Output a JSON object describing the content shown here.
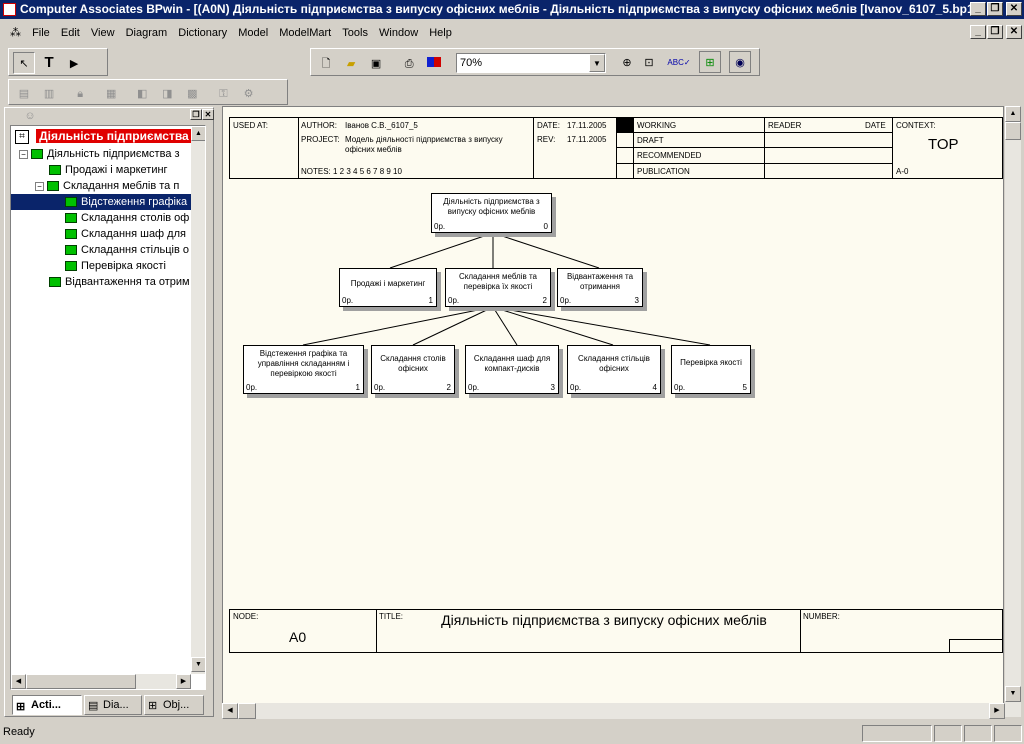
{
  "window": {
    "title": "Computer Associates BPwin - [(A0N) Діяльність підприємства  з випуску офісних меблів - Діяльність підприємства  з випуску офісних меблів  [Ivanov_6107_5.bp1]]"
  },
  "menu": [
    "File",
    "Edit",
    "View",
    "Diagram",
    "Dictionary",
    "Model",
    "ModelMart",
    "Tools",
    "Window",
    "Help"
  ],
  "toolbar": {
    "zoom": "70%"
  },
  "tree": {
    "root": "Діяльність підприємства",
    "items": [
      "Діяльність підприємства  з",
      "Продажі і маркетинг",
      "Складання меблів та  п",
      "Відстеження графіка",
      "Складання столів оф",
      "Складання шаф для",
      "Складання стільців о",
      "Перевірка якості",
      "Відвантаження та отрим"
    ]
  },
  "tabs": [
    "Acti...",
    "Dia...",
    "Obj..."
  ],
  "header": {
    "used_at": "USED AT:",
    "author_label": "AUTHOR:",
    "author": "Іванов С.В._6107_5",
    "project_label": "PROJECT:",
    "project": "Модель діяльності підприємства з випуску офісних меблів",
    "notes": "NOTES:  1  2  3  4  5  6  7  8  9  10",
    "date_label": "DATE:",
    "date": "17.11.2005",
    "rev_label": "REV:",
    "rev": "17.11.2005",
    "status": [
      "WORKING",
      "DRAFT",
      "RECOMMENDED",
      "PUBLICATION"
    ],
    "reader": "READER",
    "reader_date": "DATE",
    "context_label": "CONTEXT:",
    "context": "TOP",
    "context_node": "A-0"
  },
  "footer": {
    "node_label": "NODE:",
    "node": "A0",
    "title_label": "TITLE:",
    "title": "Діяльність підприємства  з випуску офісних меблів",
    "number_label": "NUMBER:"
  },
  "nodes": {
    "root": {
      "label": "Діяльність підприємства з випуску офісних меблів",
      "cost": "0р.",
      "num": "0"
    },
    "l1": [
      {
        "label": "Продажі і маркетинг",
        "cost": "0р.",
        "num": "1"
      },
      {
        "label": "Складання меблів та перевірка їх якості",
        "cost": "0р.",
        "num": "2"
      },
      {
        "label": "Відвантаження та отримання",
        "cost": "0р.",
        "num": "3"
      }
    ],
    "l2": [
      {
        "label": "Відстеження графіка та управління складанням і перевіркою якості",
        "cost": "0р.",
        "num": "1"
      },
      {
        "label": "Складання столів офісних",
        "cost": "0р.",
        "num": "2"
      },
      {
        "label": "Складання шаф для компакт-дисків",
        "cost": "0р.",
        "num": "3"
      },
      {
        "label": "Складання стільців офісних",
        "cost": "0р.",
        "num": "4"
      },
      {
        "label": "Перевірка якості",
        "cost": "0р.",
        "num": "5"
      }
    ]
  },
  "status_text": "Ready"
}
